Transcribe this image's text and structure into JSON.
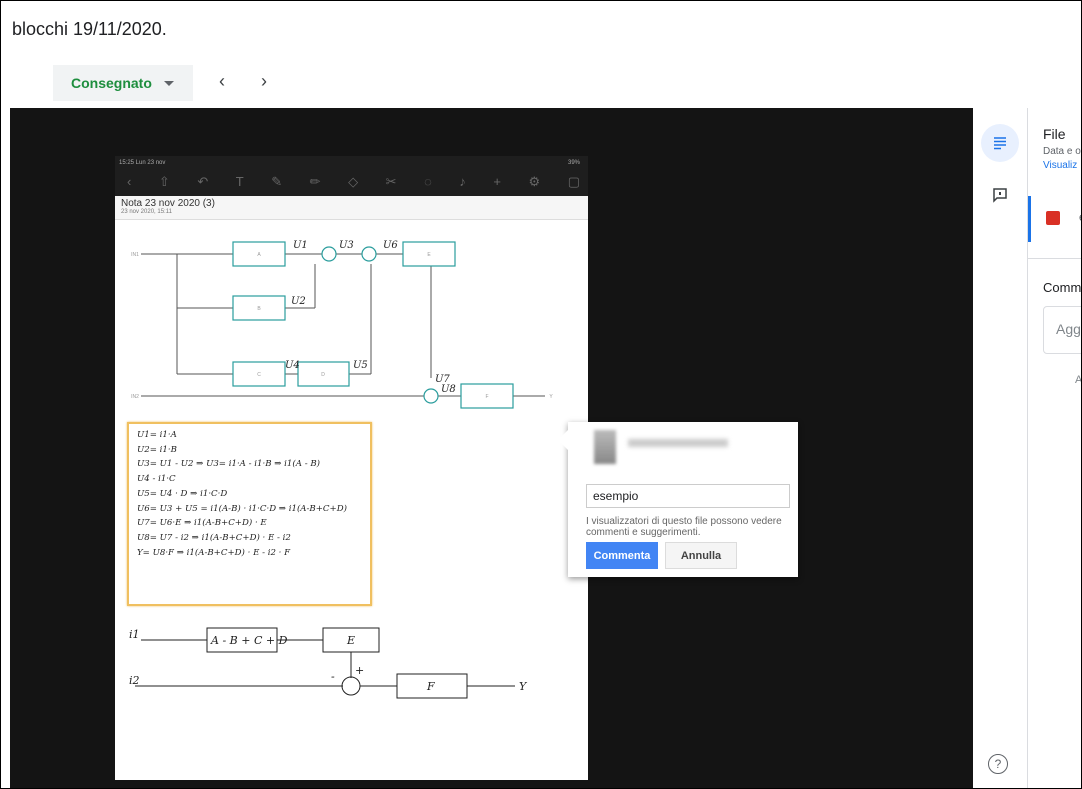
{
  "header": {
    "title": "blocchi 19/11/2020.",
    "status_label": "Consegnato",
    "prev_label": "‹",
    "next_label": "›"
  },
  "document": {
    "status_time": "15:25  Lun 23 nov",
    "status_battery": "39%",
    "note_title": "Nota 23 nov 2020 (3)",
    "note_date": "23 nov 2020, 15:11",
    "diagram": {
      "in1": "IN1",
      "in2": "IN2",
      "out": "Y",
      "block_a": "A",
      "block_b": "B",
      "block_c": "C",
      "block_d": "D",
      "block_e": "E",
      "block_f": "F",
      "u1": "U1",
      "u2": "U2",
      "u3": "U3",
      "u4": "U4",
      "u5": "U5",
      "u6": "U6",
      "u7": "U7",
      "u8": "U8"
    },
    "notes": [
      "U1= i1·A",
      "U2= i1·B",
      "U3= U1 - U2 ⇒ U3= i1·A - i1·B ⇒ i1(A - B)",
      "U4 - i1·C",
      "U5= U4 · D ⇒ i1·C·D",
      "U6= U3 + U5 = i1(A-B) · i1·C·D ⇒ i1(A-B+C+D)",
      "U7= U6·E ⇒ i1(A-B+C+D) · E",
      "U8= U7 - i2 ⇒ i1(A-B+C+D) · E - i2",
      "Y= U8·F ⇒ i1(A-B+C+D) · E - i2 · F"
    ],
    "sketch": {
      "i1": "i1",
      "i2": "i2",
      "sum_block": "A - B + C + D",
      "e": "E",
      "f": "F",
      "y": "Y",
      "minus": "-",
      "plus": "+"
    }
  },
  "popup": {
    "input_value": "esempio",
    "info": "I visualizzatori di questo file possono vedere commenti e suggerimenti.",
    "comment_label": "Commenta",
    "cancel_label": "Annulla"
  },
  "panel": {
    "file_title": "File",
    "file_sub": "Data e o",
    "view_link": "Visualiz",
    "file_name": "e",
    "comments_title": "Comm",
    "comment_placeholder": "Agg",
    "comment_hint": "A",
    "help_label": "?"
  },
  "colors": {
    "accent": "#1a73e8",
    "status_green": "#1e8e3e",
    "button_blue": "#4285f4",
    "file_red": "#d93025",
    "block_teal": "#2a9d9d",
    "note_border": "#f0c060"
  },
  "icons": {
    "details": "details-list-icon",
    "comments": "comment-icon",
    "help": "help-icon",
    "zoom": "zoom-icon",
    "image": "image-file-icon"
  }
}
